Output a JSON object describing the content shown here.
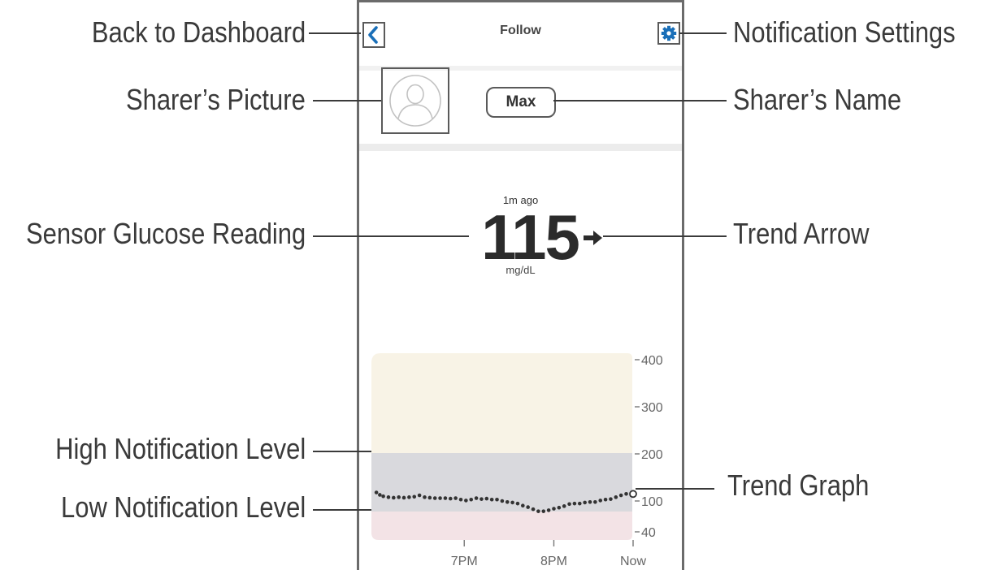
{
  "screen": {
    "title": "Follow",
    "sharer_name": "Max",
    "reading": {
      "time_ago": "1m ago",
      "value": "115",
      "unit": "mg/dL",
      "trend": "steady",
      "trend_icon": "arrow-right-icon"
    }
  },
  "icons": {
    "back": "chevron-left-icon",
    "settings": "gear-icon",
    "avatar": "person-icon"
  },
  "colors": {
    "accent": "#1a6fb8",
    "high_zone": "#f8f3e6",
    "target_zone": "#d9d9dd",
    "low_zone": "#f3e3e6",
    "trace": "#333333",
    "callout_text": "#3a3a3a"
  },
  "callouts": {
    "back": "Back to Dashboard",
    "picture": "Sharer’s Picture",
    "reading": "Sensor Glucose Reading",
    "high": "High Notification Level",
    "low": "Low Notification Level",
    "settings": "Notification Settings",
    "name": "Sharer’s Name",
    "trend_arrow": "Trend Arrow",
    "trend_graph": "Trend Graph"
  },
  "chart_data": {
    "type": "scatter",
    "y_ticks": [
      400,
      300,
      200,
      100,
      40
    ],
    "y_tick_labels": [
      "400",
      "300",
      "200",
      "100",
      "40"
    ],
    "x_ticks": [
      "7PM",
      "8PM",
      "Now"
    ],
    "x_tick_minutes": [
      -98,
      -46,
      0
    ],
    "high_level": 200,
    "low_level": 70,
    "xlabel": "",
    "ylabel": "",
    "series": [
      {
        "x_minutes": [
          -149,
          -147,
          -145,
          -142,
          -139,
          -136,
          -133,
          -130,
          -127,
          -124,
          -121,
          -118,
          -115,
          -112,
          -109,
          -106,
          -103,
          -100,
          -97,
          -94,
          -91,
          -88,
          -85,
          -82,
          -79,
          -76,
          -73,
          -70,
          -67,
          -64,
          -61,
          -58,
          -55,
          -52,
          -49,
          -46,
          -43,
          -40,
          -37,
          -34,
          -31,
          -28,
          -25,
          -22,
          -19,
          -16,
          -13,
          -10,
          -7,
          -4,
          -1
        ],
        "values": [
          118,
          113,
          110,
          108,
          107,
          108,
          107,
          108,
          109,
          112,
          108,
          107,
          106,
          106,
          106,
          105,
          106,
          103,
          101,
          103,
          106,
          104,
          105,
          103,
          103,
          100,
          98,
          97,
          95,
          91,
          88,
          84,
          80,
          80,
          82,
          85,
          87,
          90,
          94,
          95,
          95,
          97,
          98,
          98,
          101,
          103,
          104,
          108,
          112,
          115,
          112
        ]
      }
    ],
    "current": {
      "x_minutes": 0,
      "value": 115
    }
  }
}
